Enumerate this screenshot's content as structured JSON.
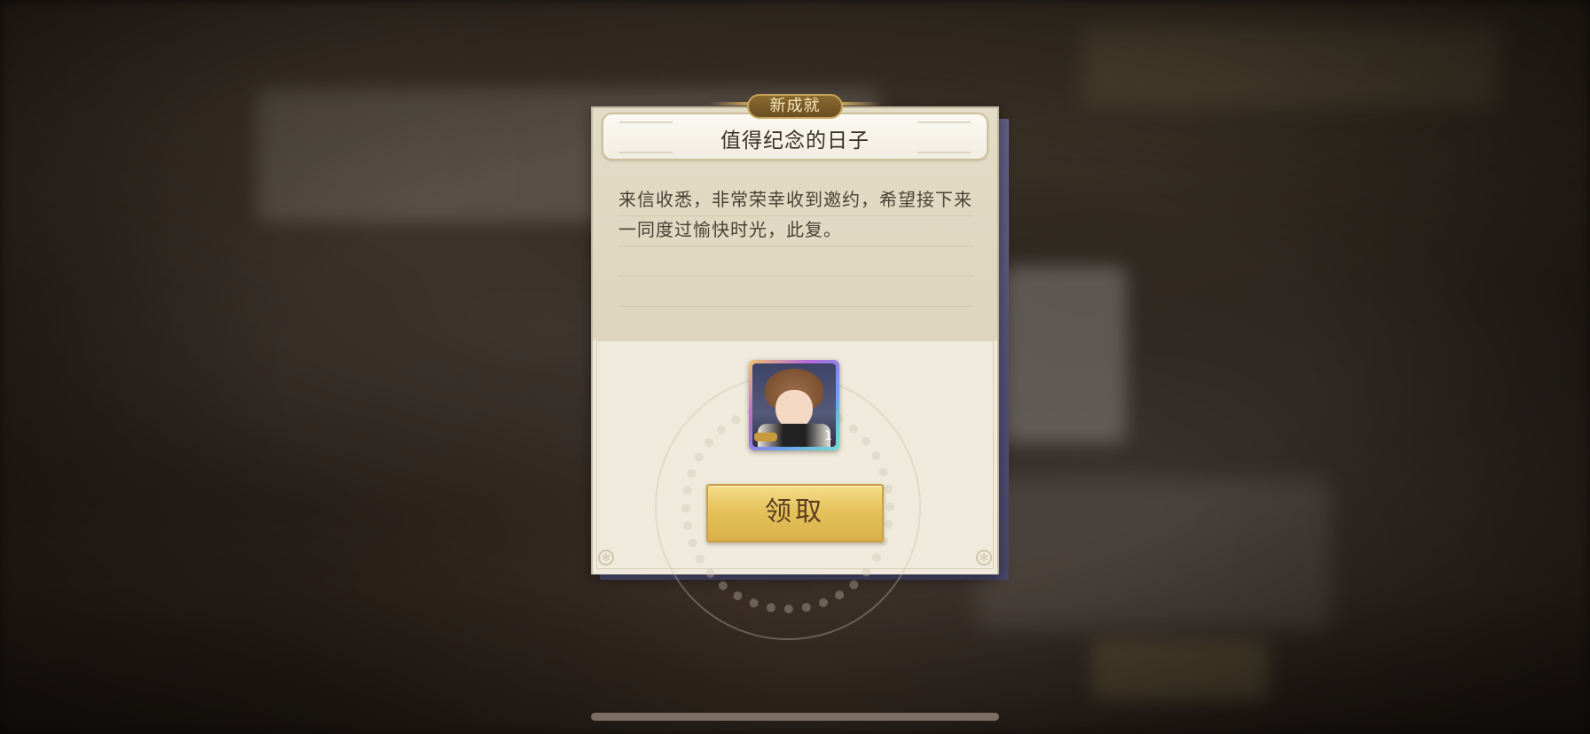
{
  "badge": {
    "label": "新成就"
  },
  "achievement": {
    "title": "值得纪念的日子",
    "letter_lines": [
      "来信收悉，非常荣幸收到邀约，希望接下来",
      "一同度过愉快时光，此复。"
    ]
  },
  "reward": {
    "icon": "character-portrait-icon",
    "count": "1"
  },
  "claim_button": {
    "label": "领取"
  },
  "colors": {
    "badge_bg": "#6b4f22",
    "badge_text": "#f6e7b8",
    "card_bg": "#efe9d9",
    "button_gold": "#e5c25a"
  }
}
